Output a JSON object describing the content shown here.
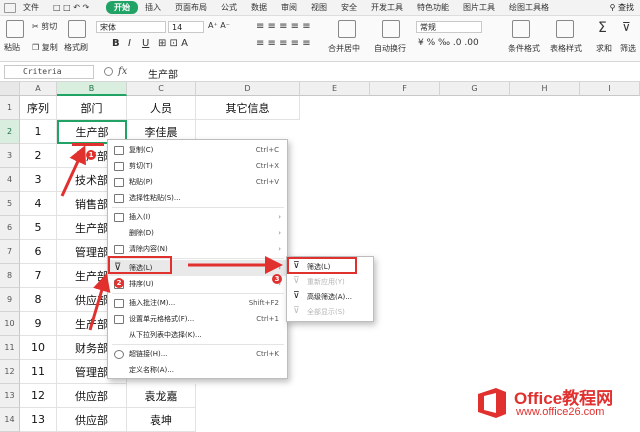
{
  "menu_tabs": [
    "文件",
    "开始",
    "插入",
    "页面布局",
    "公式",
    "数据",
    "审阅",
    "视图",
    "安全",
    "开发工具",
    "特色功能",
    "图片工具",
    "绘图工具格",
    "查找"
  ],
  "ribbon": {
    "paste": "粘贴",
    "cut": "剪切",
    "copy": "复制",
    "format_painter": "格式刷",
    "font_name": "宋体",
    "font_size": "14",
    "bold": "B",
    "italic": "I",
    "underline": "U",
    "merge_center": "合并居中",
    "wrap_text": "自动换行",
    "number_format": "常规",
    "conditional_format": "条件格式",
    "table_style": "表格样式",
    "sum": "求和",
    "filter": "筛选"
  },
  "formula_bar": {
    "name_box": "Criteria",
    "fx": "fx",
    "content": "生产部"
  },
  "columns": [
    "A",
    "B",
    "C",
    "D",
    "E",
    "F",
    "G",
    "H",
    "I"
  ],
  "rows": [
    {
      "num": "1",
      "a": "序列",
      "b": "部门",
      "c": "人员",
      "d": "其它信息"
    },
    {
      "num": "2",
      "a": "1",
      "b": "生产部",
      "c": "李佳晨",
      "d": ""
    },
    {
      "num": "3",
      "a": "2",
      "b": "生产部",
      "c": "",
      "d": ""
    },
    {
      "num": "4",
      "a": "3",
      "b": "技术部",
      "c": "",
      "d": ""
    },
    {
      "num": "5",
      "a": "4",
      "b": "销售部",
      "c": "",
      "d": ""
    },
    {
      "num": "6",
      "a": "5",
      "b": "生产部",
      "c": "",
      "d": ""
    },
    {
      "num": "7",
      "a": "6",
      "b": "管理部",
      "c": "",
      "d": ""
    },
    {
      "num": "8",
      "a": "7",
      "b": "生产部",
      "c": "",
      "d": ""
    },
    {
      "num": "9",
      "a": "8",
      "b": "供应部",
      "c": "",
      "d": ""
    },
    {
      "num": "10",
      "a": "9",
      "b": "生产部",
      "c": "",
      "d": ""
    },
    {
      "num": "11",
      "a": "10",
      "b": "财务部",
      "c": "",
      "d": ""
    },
    {
      "num": "12",
      "a": "11",
      "b": "管理部",
      "c": "",
      "d": ""
    },
    {
      "num": "13",
      "a": "12",
      "b": "供应部",
      "c": "袁龙嘉",
      "d": ""
    },
    {
      "num": "14",
      "a": "13",
      "b": "供应部",
      "c": "袁坤",
      "d": ""
    }
  ],
  "context_menu": [
    {
      "label": "复制(C)",
      "shortcut": "Ctrl+C",
      "icon": "copy-icon"
    },
    {
      "label": "剪切(T)",
      "shortcut": "Ctrl+X",
      "icon": "scissors-icon"
    },
    {
      "label": "粘贴(P)",
      "shortcut": "Ctrl+V",
      "icon": "paste-icon"
    },
    {
      "label": "选择性粘贴(S)...",
      "shortcut": "",
      "icon": "paste-special-icon"
    },
    {
      "label": "插入(I)",
      "shortcut": "",
      "icon": "insert-icon",
      "submenu": true
    },
    {
      "label": "删除(D)",
      "shortcut": "",
      "icon": "",
      "submenu": true
    },
    {
      "label": "清除内容(N)",
      "shortcut": "",
      "icon": "eraser-icon",
      "submenu": true
    },
    {
      "label": "筛选(L)",
      "shortcut": "",
      "icon": "filter-icon",
      "submenu": true,
      "highlighted": true
    },
    {
      "label": "排序(U)",
      "shortcut": "",
      "icon": "sort-icon",
      "submenu": true
    },
    {
      "label": "插入批注(M)...",
      "shortcut": "Shift+F2",
      "icon": "comment-icon"
    },
    {
      "label": "设置单元格格式(F)...",
      "shortcut": "Ctrl+1",
      "icon": "format-cells-icon"
    },
    {
      "label": "从下拉列表中选择(K)...",
      "shortcut": "",
      "icon": ""
    },
    {
      "label": "超链接(H)...",
      "shortcut": "Ctrl+K",
      "icon": "link-icon"
    },
    {
      "label": "定义名称(A)...",
      "shortcut": "",
      "icon": ""
    }
  ],
  "filter_submenu": [
    {
      "label": "筛选(L)",
      "enabled": true
    },
    {
      "label": "重新应用(Y)",
      "enabled": false
    },
    {
      "label": "高级筛选(A)...",
      "enabled": true
    },
    {
      "label": "全部显示(S)",
      "enabled": false
    }
  ],
  "annotations": {
    "badge1": "1",
    "badge2": "2",
    "badge3": "3",
    "color": "#e0312f"
  },
  "watermark": {
    "title": "Office教程网",
    "url": "www.office26.com"
  }
}
